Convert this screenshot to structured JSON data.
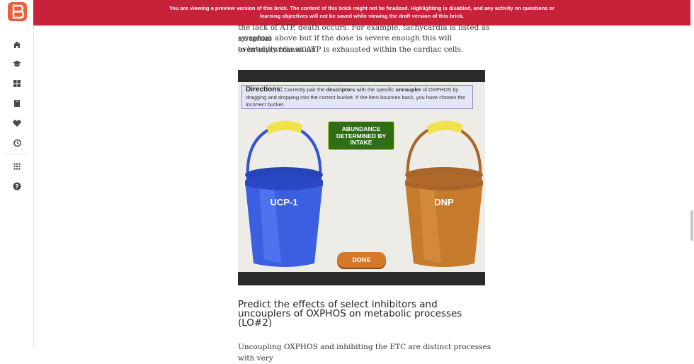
{
  "banner": {
    "line1": "You are viewing a preview version of this brick. The content of this brick might not be finalized. Highlighting is disabled, and any activity on questions or",
    "line2": "learning objectives will not be saved while viewing the draft version of this brick."
  },
  "sidebar": {
    "logo": "brillder-logo-icon",
    "items": [
      {
        "icon": "home-icon"
      },
      {
        "icon": "graduation-cap-icon"
      },
      {
        "icon": "dashboard-icon"
      },
      {
        "icon": "library-icon"
      },
      {
        "icon": "heart-icon"
      },
      {
        "icon": "history-icon"
      },
      {
        "icon": "apps-grid-icon"
      },
      {
        "icon": "help-icon"
      }
    ]
  },
  "content": {
    "line1": "the lack of ATP, death occurs.  For example, tachycardia is listed as an initial",
    "line2": "symptom above but if the dose is severe enough this will eventually transition",
    "line3": "to bradycardia as ATP is exhausted within the cardiac cells.",
    "heading": "Predict the effects of select inhibitors and uncouplers of OXPHOS on metabolic processes (LO#2)",
    "bottom_line": "Uncoupling OXPHOS and inhibiting the ETC are distinct processes with very"
  },
  "game": {
    "directions_title": "Directions:",
    "directions_t1": " Correctly pair the ",
    "directions_b1": "descriptors",
    "directions_t2": " with the specific ",
    "directions_b2": "uncoupler",
    "directions_t3": " of OXPHOS by dragging and dropping into the correct bucket. If the item bounces back, you have chosen the incorrect bucket.",
    "card_l1": "ABUNDANCE",
    "card_l2": "DETERMINED BY",
    "card_l3": "INTAKE",
    "bucket_left": "UCP-1",
    "bucket_right": "DNP",
    "done": "DONE"
  },
  "colors": {
    "banner": "#c8213a",
    "logo": "#e8613a",
    "card": "#2f6e13",
    "bucket_blue": "#3a5fe0",
    "bucket_orange": "#c57a2c",
    "handle": "#f0e24a",
    "done": "#d4782a"
  }
}
